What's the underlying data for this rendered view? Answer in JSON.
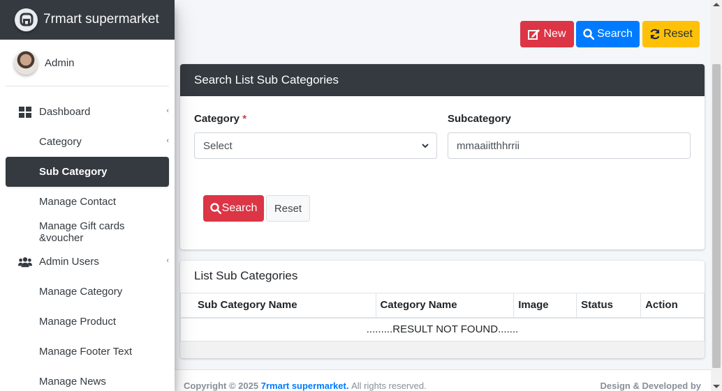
{
  "brand": {
    "name": "7rmart supermarket"
  },
  "user": {
    "name": "Admin"
  },
  "sidebar": {
    "items": [
      {
        "label": "Dashboard",
        "icon": "dashboard-icon",
        "level": 0,
        "active": false
      },
      {
        "label": "Category",
        "level": 1,
        "active": false
      },
      {
        "label": "Sub Category",
        "level": 1,
        "active": true
      },
      {
        "label": "Manage Contact",
        "level": 1,
        "active": false
      },
      {
        "label": "Manage Gift cards &voucher",
        "level": 1,
        "active": false
      },
      {
        "label": "Admin Users",
        "icon": "users-icon",
        "level": 0,
        "active": false
      },
      {
        "label": "Manage Category",
        "level": 1,
        "active": false
      },
      {
        "label": "Manage Product",
        "level": 1,
        "active": false
      },
      {
        "label": "Manage Footer Text",
        "level": 1,
        "active": false
      },
      {
        "label": "Manage News",
        "level": 1,
        "active": false
      }
    ]
  },
  "toolbar": {
    "new_label": "New",
    "search_label": "Search",
    "reset_label": "Reset"
  },
  "search_card": {
    "title": "Search List Sub Categories",
    "category_label": "Category",
    "required_mark": "*",
    "category_value": "Select",
    "subcategory_label": "Subcategory",
    "subcategory_value": "mmaaiitthhrrii",
    "search_button": "Search",
    "reset_button": "Reset"
  },
  "list_card": {
    "title": "List Sub Categories",
    "columns": [
      "Sub Category Name",
      "Category Name",
      "Image",
      "Status",
      "Action"
    ],
    "empty_message": ".........RESULT NOT FOUND......."
  },
  "footer": {
    "copyright_prefix": "Copyright © 2025",
    "brand_link": "7rmart supermarket.",
    "rights": "All rights reserved.",
    "right_text": "Design & Developed by"
  },
  "colors": {
    "danger": "#dc3545",
    "primary": "#007bff",
    "warning": "#ffc107",
    "dark": "#343a40"
  }
}
